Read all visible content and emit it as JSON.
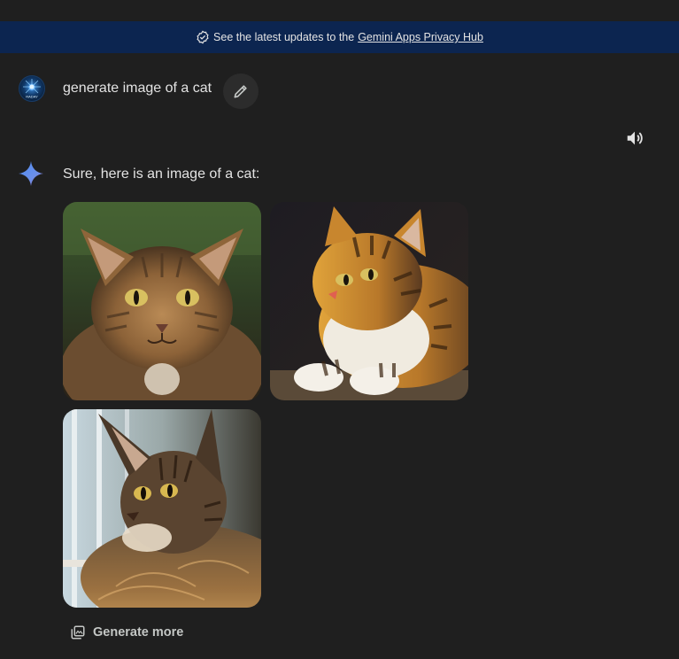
{
  "banner": {
    "text": "See the latest updates to the",
    "link": "Gemini Apps Privacy Hub",
    "icon": "verified-check-icon"
  },
  "user": {
    "avatar_label": "RADAY",
    "prompt": "generate image of a cat",
    "edit_icon": "pencil-icon"
  },
  "response": {
    "speaker_icon": "speaker-icon",
    "logo_icon": "gemini-spark-icon",
    "text": "Sure, here is an image of a cat:",
    "images": [
      {
        "desc": "tabby cat facing forward"
      },
      {
        "desc": "orange striped cat lying in sunlight"
      },
      {
        "desc": "maine coon cat by window"
      }
    ],
    "generate_more": "Generate more",
    "generate_more_icon": "image-stack-icon"
  },
  "colors": {
    "background": "#1f1f1f",
    "banner": "#0c2550",
    "text": "#e3e3e3",
    "accent_blue": "#4c8df6"
  }
}
